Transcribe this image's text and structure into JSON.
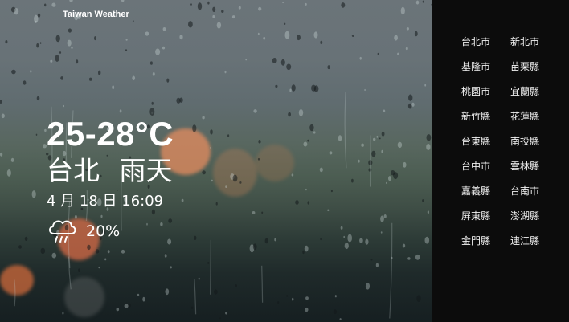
{
  "app": {
    "title": "Taiwan Weather"
  },
  "weather": {
    "temperature_range": "25-28°C",
    "city": "台北",
    "condition": "雨天",
    "datetime": "4 月 18 日 16:09",
    "rain_chance": "20%",
    "icon": "rain-cloud-icon"
  },
  "cities": [
    {
      "name": "台北市",
      "id": "taipei"
    },
    {
      "name": "新北市",
      "id": "new-taipei"
    },
    {
      "name": "基隆市",
      "id": "keelung"
    },
    {
      "name": "苗栗縣",
      "id": "miaoli"
    },
    {
      "name": "桃園市",
      "id": "taoyuan"
    },
    {
      "name": "宜蘭縣",
      "id": "yilan"
    },
    {
      "name": "新竹縣",
      "id": "hsinchu"
    },
    {
      "name": "花蓮縣",
      "id": "hualien"
    },
    {
      "name": "台東縣",
      "id": "taitung"
    },
    {
      "name": "南投縣",
      "id": "nantou"
    },
    {
      "name": "台中市",
      "id": "taichung"
    },
    {
      "name": "雲林縣",
      "id": "yunlin"
    },
    {
      "name": "嘉義縣",
      "id": "chiayi"
    },
    {
      "name": "台南市",
      "id": "tainan"
    },
    {
      "name": "屏東縣",
      "id": "pingtung"
    },
    {
      "name": "澎湖縣",
      "id": "penghu"
    },
    {
      "name": "金門縣",
      "id": "kinmen"
    },
    {
      "name": "連江縣",
      "id": "lienchiang"
    }
  ],
  "colors": {
    "sidebar_bg": "#0c0c0c",
    "text": "#ffffff"
  }
}
